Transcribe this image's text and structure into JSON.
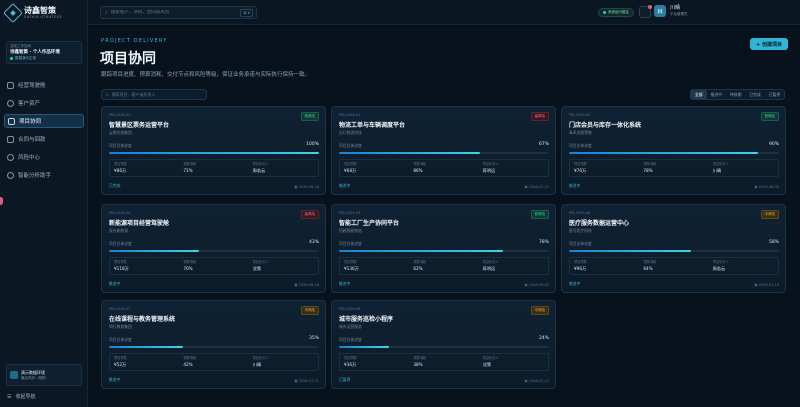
{
  "brand": {
    "name": "诗鑫智策",
    "tagline": "SHIXIN STRATEGY"
  },
  "workspace": {
    "label": "当前工作空间",
    "name": "诗鑫智策 · 个人作品环境",
    "status": "数据演示正常"
  },
  "nav": {
    "items": [
      {
        "label": "经营驾驶舱",
        "icon": "dashboard-icon"
      },
      {
        "label": "客户资产",
        "icon": "user-icon"
      },
      {
        "label": "项目协同",
        "icon": "folder-icon"
      },
      {
        "label": "合同与回款",
        "icon": "file-icon"
      },
      {
        "label": "风险中心",
        "icon": "shield-icon"
      },
      {
        "label": "智能分析助手",
        "icon": "assistant-icon"
      }
    ]
  },
  "demo_env": {
    "title": "演示数据环境",
    "subtitle": "最后同步：刚刚"
  },
  "collapse_label": "收起导航",
  "topbar": {
    "search_placeholder": "搜索客户、项目、合同或风险",
    "shortcut": "⌘ K",
    "system_status": "系统运行稳定",
    "user": {
      "initial": "川",
      "name": "川晴",
      "role": "平台管理员"
    }
  },
  "header": {
    "kicker": "PROJECT DELIVERY",
    "title": "项目协同",
    "description": "跟踪项目进度、预算消耗、交付节点和风险等级，保证业务承诺与实际执行保持一致。",
    "create_button": "+ 创建项目"
  },
  "filters": {
    "search_placeholder": "搜索项目、客户或负责人",
    "tabs": [
      "全部",
      "推进中",
      "待排期",
      "已完成",
      "已暂停"
    ],
    "active_tab": 0
  },
  "labels": {
    "progress": "项目总体进度",
    "budget": "项目预算",
    "consumed": "预算消耗",
    "owner": "项目负责人"
  },
  "projects": [
    {
      "code": "PRJ-2026-01",
      "badge": "低风险",
      "risk": "low",
      "title": "智慧景区票务运营平台",
      "client": "云栖文旅集团",
      "progress": 100,
      "progress_text": "100%",
      "budget": "¥86万",
      "consumed": "71%",
      "owner": "周若云",
      "status": "已完成",
      "date": "2026-06-18"
    },
    {
      "code": "PRJ-2026-02",
      "badge": "高风险",
      "risk": "high",
      "title": "物流工单与车辆调度平台",
      "client": "远行物流科技",
      "progress": 67,
      "progress_text": "67%",
      "budget": "¥68万",
      "consumed": "86%",
      "owner": "蒋明远",
      "status": "推进中",
      "date": "2026-07-21"
    },
    {
      "code": "PRJ-2026-03",
      "badge": "低风险",
      "risk": "low",
      "title": "门店会员与库存一体化系统",
      "client": "青禾连锁零售",
      "progress": 90,
      "progress_text": "90%",
      "budget": "¥76万",
      "consumed": "78%",
      "owner": "川晴",
      "status": "推进中",
      "date": "2026-06-30"
    },
    {
      "code": "PRJ-2026-04",
      "badge": "高风险",
      "risk": "high",
      "title": "新能源项目经营驾驶舱",
      "client": "辰光新能源",
      "progress": 43,
      "progress_text": "43%",
      "budget": "¥118万",
      "consumed": "70%",
      "owner": "沈策",
      "status": "推进中",
      "date": "2026-08-16"
    },
    {
      "code": "PRJ-2026-05",
      "badge": "低风险",
      "risk": "low",
      "title": "智能工厂生产协同平台",
      "client": "恒越智能制造",
      "progress": 78,
      "progress_text": "78%",
      "budget": "¥136万",
      "consumed": "62%",
      "owner": "蒋明远",
      "status": "推进中",
      "date": "2026-09-05"
    },
    {
      "code": "PRJ-2026-06",
      "badge": "中风险",
      "risk": "mid",
      "title": "医疗服务数据运营中心",
      "client": "星河医疗科技",
      "progress": 58,
      "progress_text": "58%",
      "budget": "¥96万",
      "consumed": "64%",
      "owner": "周若云",
      "status": "推进中",
      "date": "2026-07-15"
    },
    {
      "code": "PRJ-2026-07",
      "badge": "中风险",
      "risk": "mid",
      "title": "在线课程与教务管理系统",
      "client": "知行教育集团",
      "progress": 35,
      "progress_text": "35%",
      "budget": "¥52万",
      "consumed": "42%",
      "owner": "川晴",
      "status": "推进中",
      "date": "2026-07-31"
    },
    {
      "code": "PRJ-2026-08",
      "badge": "中风险",
      "risk": "mid",
      "title": "城市服务巡检小程序",
      "client": "城市运营服务",
      "progress": 24,
      "progress_text": "24%",
      "budget": "¥36万",
      "consumed": "38%",
      "owner": "沈策",
      "status": "已暂停",
      "date": "2026-07-12"
    }
  ]
}
